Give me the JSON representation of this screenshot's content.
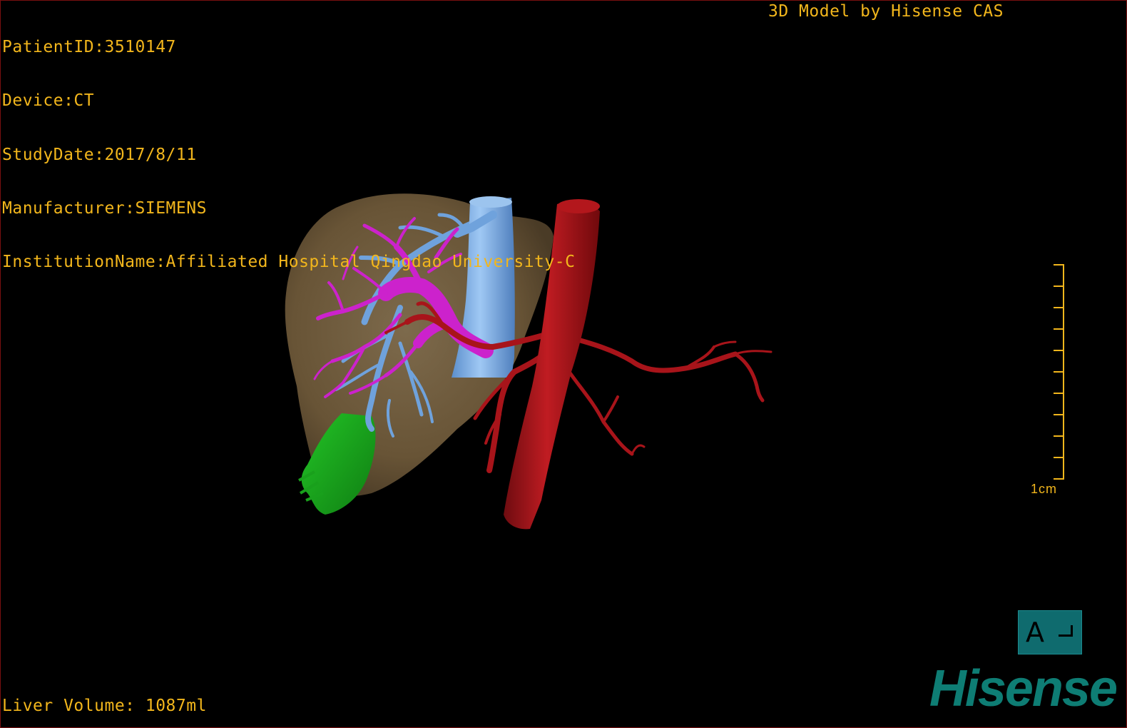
{
  "patient_info": {
    "patient_id": "PatientID:3510147",
    "device": "Device:CT",
    "study_date": "StudyDate:2017/8/11",
    "manufacturer": "Manufacturer:SIEMENS",
    "institution": "InstitutionName:Affiliated Hospital Qingdao University-C"
  },
  "brand_line": "3D Model by Hisense CAS",
  "liver_volume": "Liver Volume: 1087ml",
  "scale": {
    "label": "1cm",
    "ticks": 11
  },
  "orientation": {
    "letter": "A",
    "corner_glyph": "corner-bracket-icon"
  },
  "logo_text": "Hisense",
  "colors": {
    "overlay_text": "#f2b61c",
    "liver": "#6e5a40",
    "portal_vein": "#cc22cc",
    "hepatic_vein": "#6fa6e0",
    "ivc": "#7fb2e8",
    "artery": "#a8141a",
    "gallbladder": "#1aa81c",
    "orientation_box": "#0f6b6e",
    "logo": "#0e7d74"
  }
}
